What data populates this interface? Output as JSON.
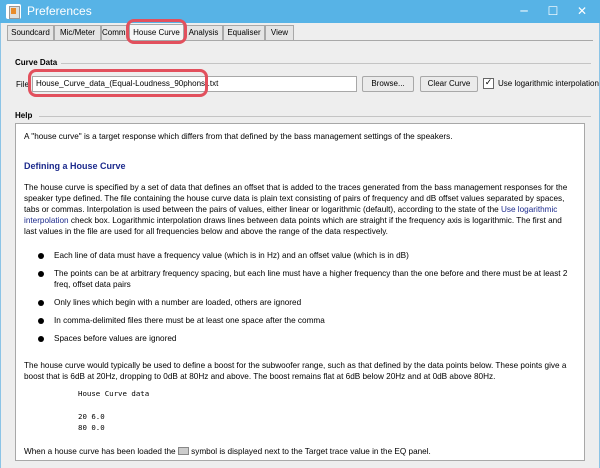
{
  "window": {
    "title": "Preferences",
    "minimize": "─",
    "maximize": "☐",
    "close": "✕"
  },
  "tabs": [
    {
      "label": "Soundcard"
    },
    {
      "label": "Mic/Meter"
    },
    {
      "label": "Comms"
    },
    {
      "label": "House Curve"
    },
    {
      "label": "Analysis"
    },
    {
      "label": "Equaliser"
    },
    {
      "label": "View"
    }
  ],
  "curve_data": {
    "section_title": "Curve Data",
    "file_label": "File",
    "file_value": "House_Curve_data_(Equal-Loudness_90phons).txt",
    "browse_label": "Browse...",
    "clear_label": "Clear Curve",
    "log_checked": true,
    "log_label": "Use logarithmic interpolation"
  },
  "help": {
    "section_title": "Help",
    "intro": "A \"house curve\" is a target response which differs from that defined by the bass management settings of the speakers.",
    "heading": "Defining a House Curve",
    "para1_a": "The house curve is specified by a set of data that defines an offset that is added to the traces generated from the bass management responses for the speaker type defined. The file containing the house curve data is plain text consisting of pairs of frequency and dB offset values separated by spaces, tabs or commas. Interpolation is used between the pairs of values, either linear or logarithmic (default), according to the state of the ",
    "para1_link": "Use logarithmic interpolation",
    "para1_b": " check box. Logarithmic interpolation draws lines between data points which are straight if the frequency axis is logarithmic. The first and last values in the file are used for all frequencies below and above the range of the data respectively.",
    "bullets": [
      "Each line of data must have a frequency value (which is in Hz) and an offset value (which is in dB)",
      "The points can be at arbitrary frequency spacing, but each line must have a higher frequency than the one before and there must be at least 2 freq, offset data pairs",
      "Only lines which begin with a number are loaded, others are ignored",
      "In comma-delimited files there must be at least one space after the comma",
      "Spaces before values are ignored"
    ],
    "para2": "The house curve would typically be used to define a boost for the subwoofer range, such as that defined by the data points below. These points give a boost that is 6dB at 20Hz, dropping to 0dB at 80Hz and above. The boost remains flat at 6dB below 20Hz and at 0dB above 80Hz.",
    "code_title": "House Curve data",
    "code_line1": "20 6.0",
    "code_line2": "80 0.0",
    "footer_a": "When a house curve has been loaded the ",
    "footer_b": " symbol is displayed next to the Target trace value in the EQ panel."
  },
  "colors": {
    "titlebar": "#57b3e6",
    "highlight": "#e2505d",
    "link": "#1c2a8c"
  }
}
